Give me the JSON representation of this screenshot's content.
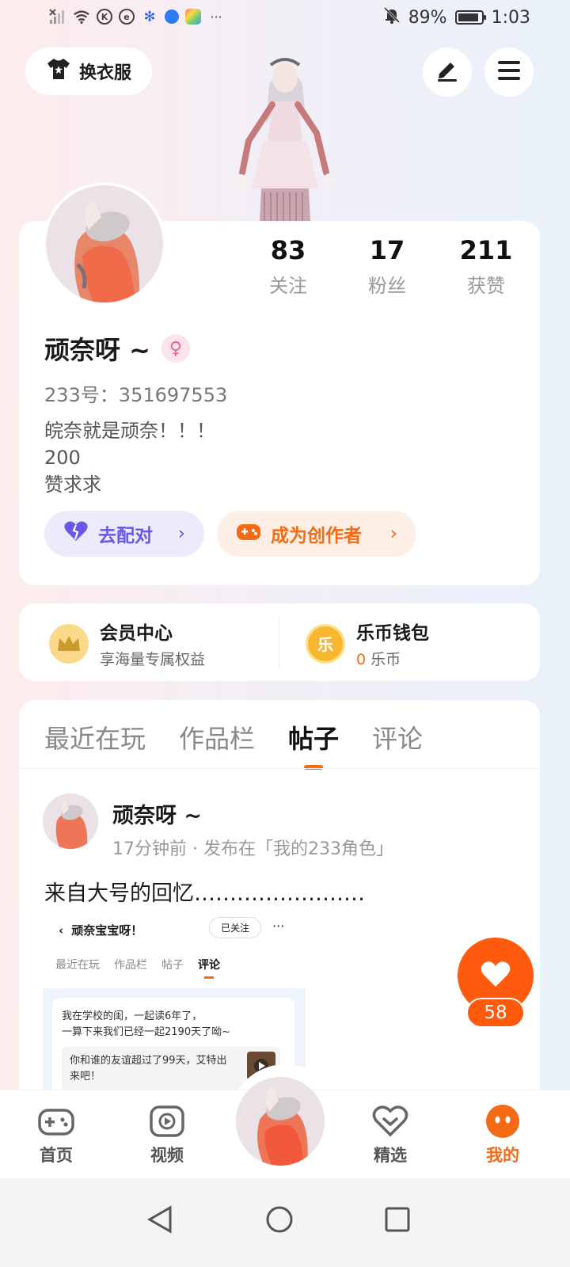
{
  "status_bar": {
    "battery": "89%",
    "battery_level": 0.89,
    "time": "1:03",
    "more": "···",
    "icons": [
      "no-signal-icon",
      "wifi-icon",
      "k-app-icon",
      "browser-app-icon",
      "baidu-icon",
      "circle-app-icon",
      "multicolor-app-icon",
      "mute-bell-icon",
      "battery-icon"
    ]
  },
  "header": {
    "wardrobe_label": "换衣服",
    "edit_icon": "pen-icon",
    "menu_icon": "hamburger-menu-icon"
  },
  "profile": {
    "stats": [
      {
        "value": "83",
        "label": "关注"
      },
      {
        "value": "17",
        "label": "粉丝"
      },
      {
        "value": "211",
        "label": "获赞"
      }
    ],
    "nickname": "顽奈呀 ~",
    "gender_symbol": "♀",
    "uid": "233号：351697553",
    "bio_lines": [
      "皖奈就是顽奈！！！",
      "200",
      "赞求求"
    ],
    "match_label": "去配对",
    "creator_label": "成为创作者",
    "chevron": "›"
  },
  "member": {
    "vip_title": "会员中心",
    "vip_sub": "享海量专属权益",
    "wallet_title": "乐币钱包",
    "wallet_amount": "0",
    "wallet_unit": "乐币",
    "coin_glyph": "乐"
  },
  "tabs": [
    {
      "label": "最近在玩",
      "active": false
    },
    {
      "label": "作品栏",
      "active": false
    },
    {
      "label": "帖子",
      "active": true
    },
    {
      "label": "评论",
      "active": false
    }
  ],
  "post": {
    "author": "顽奈呀 ~",
    "meta": "17分钟前 · 发布在「我的233角色」",
    "text": "来自大号的回忆……………………",
    "embed": {
      "back": "‹",
      "title": "顽奈宝宝呀！",
      "follow": "已关注",
      "dots": "···",
      "tabs": [
        "最近在玩",
        "作品栏",
        "帖子",
        "评论"
      ],
      "line1": "我在学校的闺，一起读6年了，",
      "line2": "一算下来我们已经一起2190天了呦~",
      "quote": "你和谁的友谊超过了99天，艾特出来吧！"
    }
  },
  "like": {
    "count": "58"
  },
  "bottom_nav": [
    {
      "label": "首页",
      "icon": "gamepad-icon",
      "active": false
    },
    {
      "label": "视频",
      "icon": "video-play-icon",
      "active": false
    },
    {
      "label": "精选",
      "icon": "heart-badge-icon",
      "active": false
    },
    {
      "label": "我的",
      "icon": "face-icon",
      "active": true
    }
  ],
  "colors": {
    "accent": "#f46b16",
    "like": "#ff5a0e",
    "match_purple": "#6658e8"
  }
}
